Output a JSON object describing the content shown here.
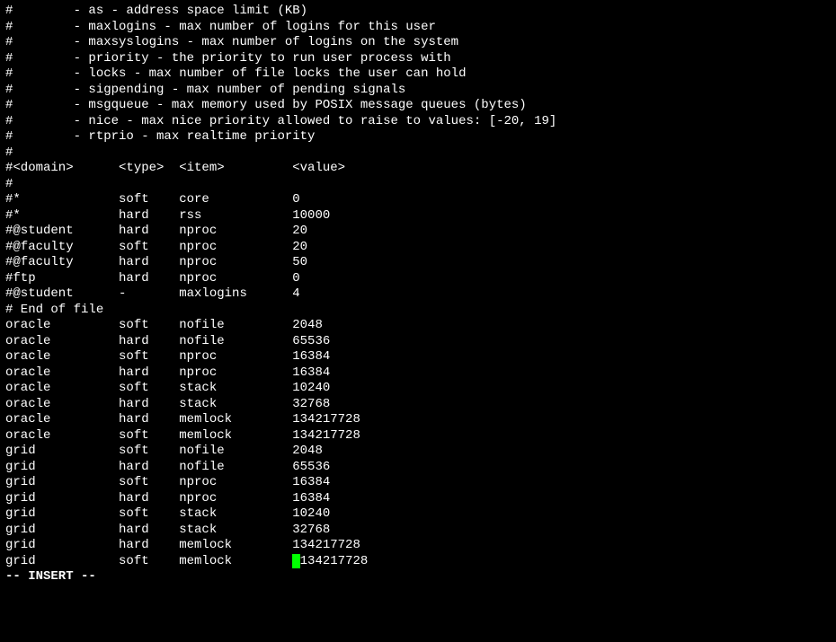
{
  "comment_lines": [
    "#        - as - address space limit (KB)",
    "#        - maxlogins - max number of logins for this user",
    "#        - maxsyslogins - max number of logins on the system",
    "#        - priority - the priority to run user process with",
    "#        - locks - max number of file locks the user can hold",
    "#        - sigpending - max number of pending signals",
    "#        - msgqueue - max memory used by POSIX message queues (bytes)",
    "#        - nice - max nice priority allowed to raise to values: [-20, 19]",
    "#        - rtprio - max realtime priority",
    "#",
    "#<domain>      <type>  <item>         <value>",
    "#"
  ],
  "example_rows": [
    {
      "domain": "#*",
      "type": "soft",
      "item": "core",
      "value": "0"
    },
    {
      "domain": "#*",
      "type": "hard",
      "item": "rss",
      "value": "10000"
    },
    {
      "domain": "#@student",
      "type": "hard",
      "item": "nproc",
      "value": "20"
    },
    {
      "domain": "#@faculty",
      "type": "soft",
      "item": "nproc",
      "value": "20"
    },
    {
      "domain": "#@faculty",
      "type": "hard",
      "item": "nproc",
      "value": "50"
    },
    {
      "domain": "#ftp",
      "type": "hard",
      "item": "nproc",
      "value": "0"
    },
    {
      "domain": "#@student",
      "type": "-",
      "item": "maxlogins",
      "value": "4"
    }
  ],
  "end_comment": "# End of file",
  "limits_rows": [
    {
      "domain": "oracle",
      "type": "soft",
      "item": "nofile",
      "value": "2048"
    },
    {
      "domain": "oracle",
      "type": "hard",
      "item": "nofile",
      "value": "65536"
    },
    {
      "domain": "oracle",
      "type": "soft",
      "item": "nproc",
      "value": "16384"
    },
    {
      "domain": "oracle",
      "type": "hard",
      "item": "nproc",
      "value": "16384"
    },
    {
      "domain": "oracle",
      "type": "soft",
      "item": "stack",
      "value": "10240"
    },
    {
      "domain": "oracle",
      "type": "hard",
      "item": "stack",
      "value": "32768"
    },
    {
      "domain": "oracle",
      "type": "hard",
      "item": "memlock",
      "value": "134217728"
    },
    {
      "domain": "oracle",
      "type": "soft",
      "item": "memlock",
      "value": "134217728"
    },
    {
      "domain": "grid",
      "type": "soft",
      "item": "nofile",
      "value": "2048"
    },
    {
      "domain": "grid",
      "type": "hard",
      "item": "nofile",
      "value": "65536"
    },
    {
      "domain": "grid",
      "type": "soft",
      "item": "nproc",
      "value": "16384"
    },
    {
      "domain": "grid",
      "type": "hard",
      "item": "nproc",
      "value": "16384"
    },
    {
      "domain": "grid",
      "type": "soft",
      "item": "stack",
      "value": "10240"
    },
    {
      "domain": "grid",
      "type": "hard",
      "item": "stack",
      "value": "32768"
    },
    {
      "domain": "grid",
      "type": "hard",
      "item": "memlock",
      "value": "134217728"
    },
    {
      "domain": "grid",
      "type": "soft",
      "item": "memlock",
      "value": "134217728",
      "cursor_before_value": true
    }
  ],
  "mode_line": "-- INSERT --",
  "columns": {
    "domain_width": 15,
    "type_width": 8,
    "item_width": 15
  }
}
